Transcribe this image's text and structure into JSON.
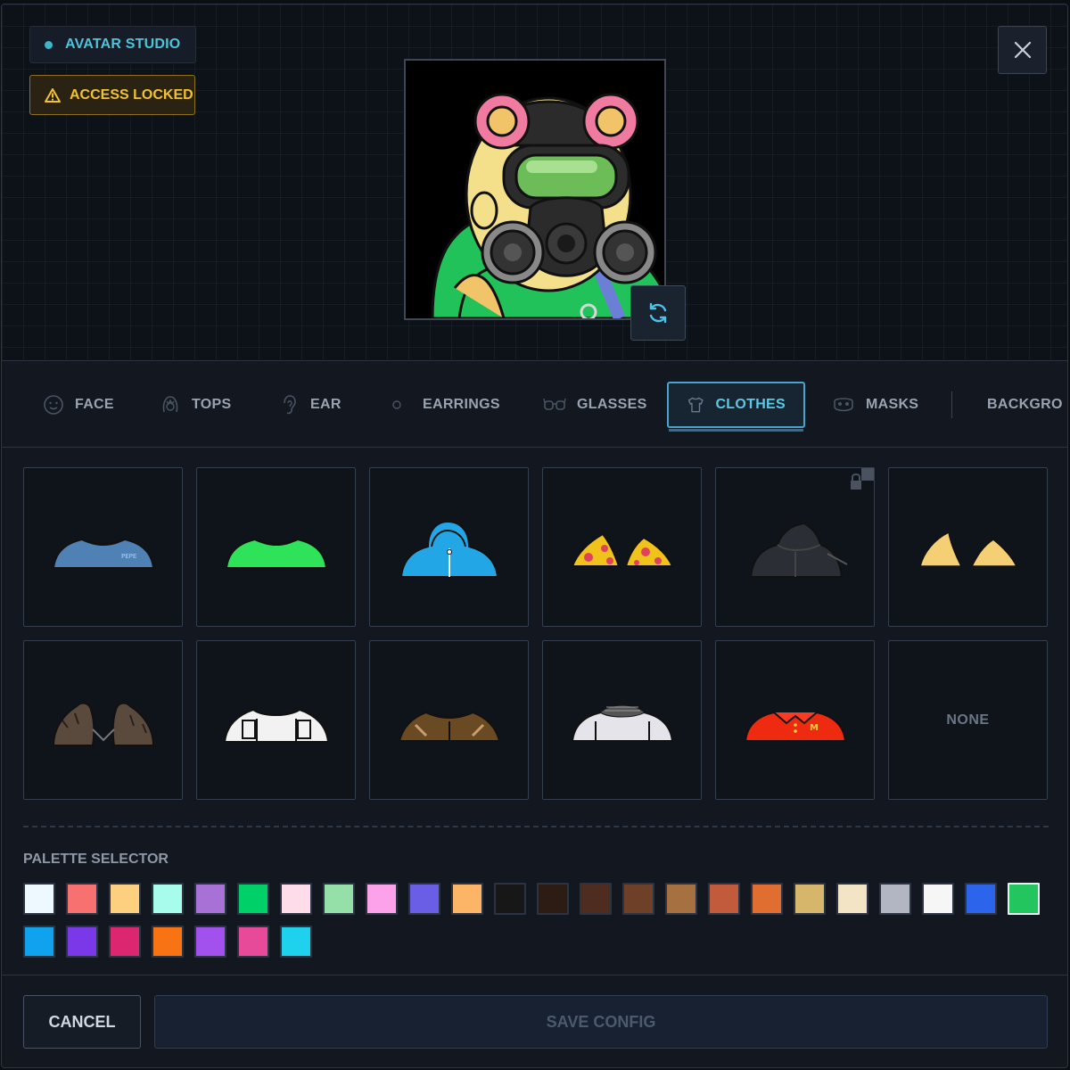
{
  "header": {
    "studio_label": "AVATAR STUDIO",
    "locked_label": "ACCESS LOCKED",
    "close_icon": "close-icon",
    "refresh_icon": "refresh-icon"
  },
  "tabs": [
    {
      "label": "FACE",
      "icon": "face-icon"
    },
    {
      "label": "TOPS",
      "icon": "hair-icon"
    },
    {
      "label": "EAR",
      "icon": "ear-icon"
    },
    {
      "label": "EARRINGS",
      "icon": "earring-icon"
    },
    {
      "label": "GLASSES",
      "icon": "glasses-icon"
    },
    {
      "label": "CLOTHES",
      "icon": "shirt-icon",
      "active": true
    },
    {
      "label": "MASKS",
      "icon": "mask-icon"
    },
    {
      "label": "BACKGRO",
      "icon": ""
    }
  ],
  "items": [
    {
      "name": "blue-tshirt",
      "colors": [
        "#4f81b5"
      ]
    },
    {
      "name": "green-tshirt",
      "colors": [
        "#2ee35a"
      ]
    },
    {
      "name": "blue-hoodie",
      "colors": [
        "#23a6e6"
      ]
    },
    {
      "name": "hawaiian-shirt",
      "colors": [
        "#f0c21c",
        "#e0415b"
      ]
    },
    {
      "name": "black-leather-jacket",
      "colors": [
        "#2b2f35"
      ],
      "locked": true
    },
    {
      "name": "yellow-collar",
      "colors": [
        "#f4cf73"
      ]
    },
    {
      "name": "fur-coat",
      "colors": [
        "#5a4a3e"
      ]
    },
    {
      "name": "white-tactical-vest",
      "colors": [
        "#f2f2f2"
      ]
    },
    {
      "name": "brown-jacket",
      "colors": [
        "#6a4a22"
      ]
    },
    {
      "name": "white-mesh-shirt",
      "colors": [
        "#e4e4ea"
      ]
    },
    {
      "name": "red-polo",
      "colors": [
        "#ee2a10"
      ]
    },
    {
      "name": "none",
      "label": "NONE"
    }
  ],
  "palette": {
    "title": "PALETTE SELECTOR",
    "selected_color": "#22c55e",
    "colors": [
      "#eef8ff",
      "#f87171",
      "#fcd07e",
      "#a8fcec",
      "#a871d6",
      "#00d068",
      "#ffdcea",
      "#94e0a8",
      "#fba2ea",
      "#6a5ee6",
      "#fcb466",
      "#171717",
      "#2c1c14",
      "#4e2c20",
      "#6e4028",
      "#a67040",
      "#c25a3c",
      "#e06e30",
      "#d6b66a",
      "#f4e4c6",
      "#b2b6c2",
      "#f6f6f6",
      "#2c64ec",
      "#22c55e",
      "#10a2ee",
      "#7a38e8",
      "#dc2670",
      "#f87314",
      "#a250ee",
      "#e84a9a",
      "#1ed2ee"
    ]
  },
  "footer": {
    "cancel_label": "CANCEL",
    "save_label": "SAVE CONFIG"
  }
}
